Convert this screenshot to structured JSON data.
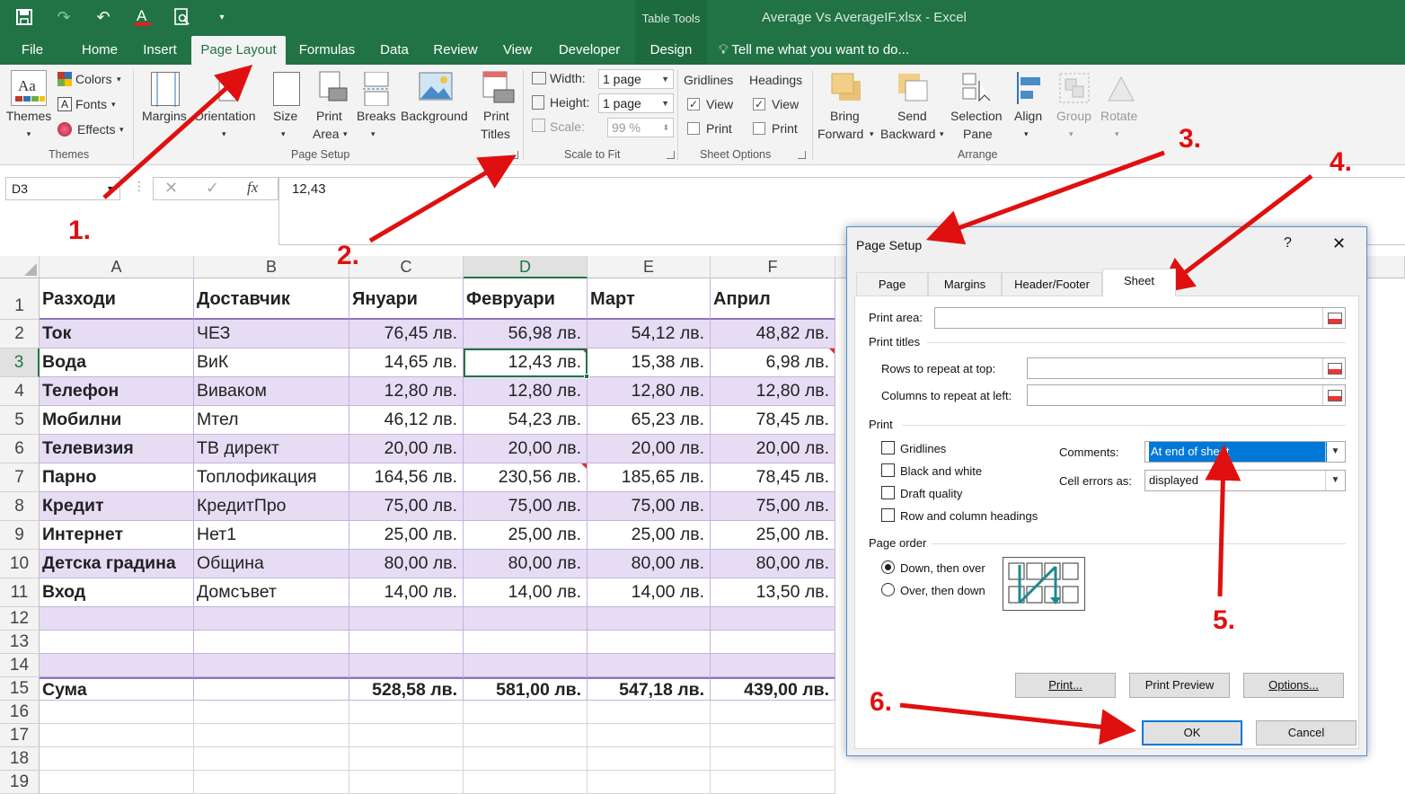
{
  "titlebar": {
    "table_tools": "Table Tools",
    "document_title": "Average Vs AverageIF.xlsx - Excel"
  },
  "tabs": {
    "file": "File",
    "home": "Home",
    "insert": "Insert",
    "page_layout": "Page Layout",
    "formulas": "Formulas",
    "data": "Data",
    "review": "Review",
    "view": "View",
    "developer": "Developer",
    "design": "Design",
    "tell_me": "Tell me what you want to do..."
  },
  "ribbon": {
    "themes": {
      "themes": "Themes",
      "colors": "Colors",
      "fonts": "Fonts",
      "effects": "Effects",
      "group": "Themes"
    },
    "page_setup": {
      "margins": "Margins",
      "orientation": "Orientation",
      "size": "Size",
      "print_area_1": "Print",
      "print_area_2": "Area",
      "breaks": "Breaks",
      "background": "Background",
      "print_titles_1": "Print",
      "print_titles_2": "Titles",
      "group": "Page Setup"
    },
    "scale": {
      "width_label": "Width:",
      "width_value": "1 page",
      "height_label": "Height:",
      "height_value": "1 page",
      "scale_label": "Scale:",
      "scale_value": "99 %",
      "group": "Scale to Fit"
    },
    "sheet_options": {
      "gridlines": "Gridlines",
      "headings": "Headings",
      "view": "View",
      "print": "Print",
      "group": "Sheet Options"
    },
    "arrange": {
      "bring_1": "Bring",
      "bring_2": "Forward",
      "send_1": "Send",
      "send_2": "Backward",
      "selection_1": "Selection",
      "selection_2": "Pane",
      "align": "Align",
      "group_btn": "Group",
      "rotate": "Rotate",
      "group": "Arrange"
    }
  },
  "formula_bar": {
    "name_box": "D3",
    "formula": "12,43"
  },
  "sheet": {
    "columns": [
      "A",
      "B",
      "C",
      "D",
      "E",
      "F"
    ],
    "rows": [
      "1",
      "2",
      "3",
      "4",
      "5",
      "6",
      "7",
      "8",
      "9",
      "10",
      "11",
      "12",
      "13",
      "14",
      "15",
      "16",
      "17",
      "18",
      "19"
    ],
    "headers": [
      "Разходи",
      "Доставчик",
      "Януари",
      "Февруари",
      "Март",
      "Април"
    ],
    "data": [
      [
        "Ток",
        "ЧЕЗ",
        "76,45 лв.",
        "56,98 лв.",
        "54,12 лв.",
        "48,82 лв."
      ],
      [
        "Вода",
        "ВиК",
        "14,65 лв.",
        "12,43 лв.",
        "15,38 лв.",
        "6,98 лв."
      ],
      [
        "Телефон",
        "Виваком",
        "12,80 лв.",
        "12,80 лв.",
        "12,80 лв.",
        "12,80 лв."
      ],
      [
        "Мобилни",
        "Мтел",
        "46,12 лв.",
        "54,23 лв.",
        "65,23 лв.",
        "78,45 лв."
      ],
      [
        "Телевизия",
        "ТВ директ",
        "20,00 лв.",
        "20,00 лв.",
        "20,00 лв.",
        "20,00 лв."
      ],
      [
        "Парно",
        "Топлофикация",
        "164,56 лв.",
        "230,56 лв.",
        "185,65 лв.",
        "78,45 лв."
      ],
      [
        "Кредит",
        "КредитПро",
        "75,00 лв.",
        "75,00 лв.",
        "75,00 лв.",
        "75,00 лв."
      ],
      [
        "Интернет",
        "Нет1",
        "25,00 лв.",
        "25,00 лв.",
        "25,00 лв.",
        "25,00 лв."
      ],
      [
        "Детска градина",
        "Община",
        "80,00 лв.",
        "80,00 лв.",
        "80,00 лв.",
        "80,00 лв."
      ],
      [
        "Вход",
        "Домсъвет",
        "14,00 лв.",
        "14,00 лв.",
        "14,00 лв.",
        "13,50 лв."
      ]
    ],
    "total": [
      "Сума",
      "",
      "528,58 лв.",
      "581,00 лв.",
      "547,18 лв.",
      "439,00 лв."
    ]
  },
  "dialog": {
    "title": "Page Setup",
    "help": "?",
    "close": "✕",
    "tabs": [
      "Page",
      "Margins",
      "Header/Footer",
      "Sheet"
    ],
    "print_area": "Print area:",
    "print_titles": "Print titles",
    "rows_repeat": "Rows to repeat at top:",
    "cols_repeat": "Columns to repeat at left:",
    "print_section": "Print",
    "gridlines": "Gridlines",
    "black_white": "Black and white",
    "draft": "Draft quality",
    "row_col_headings": "Row and column headings",
    "comments_label": "Comments:",
    "comments_value": "At end of sheet",
    "errors_label": "Cell errors as:",
    "errors_value": "displayed",
    "page_order": "Page order",
    "down_over": "Down, then over",
    "over_down": "Over, then down",
    "btn_print": "Print...",
    "btn_preview": "Print Preview",
    "btn_options": "Options...",
    "btn_ok": "OK",
    "btn_cancel": "Cancel"
  },
  "annotations": [
    "1.",
    "2.",
    "3.",
    "4.",
    "5.",
    "6."
  ],
  "colors": {
    "excel_green": "#217346",
    "band": "#e6ddf5",
    "annotation_red": "#e01010",
    "selection_blue": "#0078d7"
  }
}
